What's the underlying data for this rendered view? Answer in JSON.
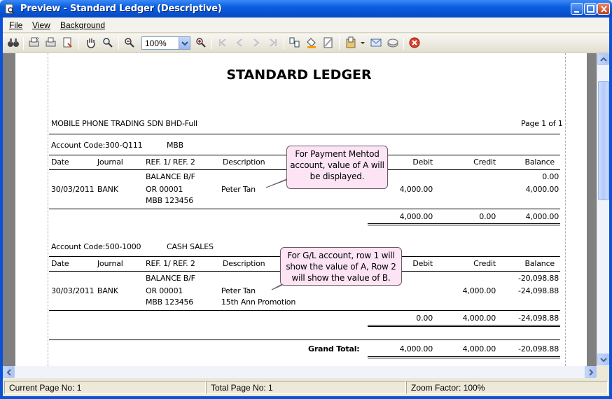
{
  "window": {
    "title": "Preview - Standard Ledger (Descriptive)"
  },
  "menu": [
    "File",
    "View",
    "Background"
  ],
  "toolbar": {
    "zoom_value": "100%"
  },
  "report": {
    "title": "STANDARD LEDGER",
    "company": "MOBILE PHONE TRADING SDN  BHD-Full",
    "page_info": "Page 1 of 1",
    "columns": {
      "date": "Date",
      "journal": "Journal",
      "ref": "REF. 1/ REF. 2",
      "description": "Description",
      "debit": "Debit",
      "credit": "Credit",
      "balance": "Balance"
    },
    "accounts": [
      {
        "label": "Account Code:",
        "code": "300-Q111",
        "name": "MBB",
        "bf_label": "BALANCE B/F",
        "bf_balance": "0.00",
        "date": "30/03/2011",
        "journal": "BANK",
        "ref1": "OR 00001",
        "ref2": "MBB 123456",
        "desc1": "Peter Tan",
        "desc2": "",
        "debit": "4,000.00",
        "credit": "",
        "balance": "4,000.00",
        "total_debit": "4,000.00",
        "total_credit": "0.00",
        "total_balance": "4,000.00"
      },
      {
        "label": "Account Code:",
        "code": "500-1000",
        "name": "CASH SALES",
        "bf_label": "BALANCE B/F",
        "bf_balance": "-20,098.88",
        "date": "30/03/2011",
        "journal": "BANK",
        "ref1": "OR 00001",
        "ref2": "MBB 123456",
        "desc1": "Peter Tan",
        "desc2": "15th Ann Promotion",
        "debit": "",
        "credit": "4,000.00",
        "balance": "-24,098.88",
        "total_debit": "0.00",
        "total_credit": "4,000.00",
        "total_balance": "-24,098.88"
      }
    ],
    "grand_total": {
      "label": "Grand Total:",
      "debit": "4,000.00",
      "credit": "4,000.00",
      "balance": "-20,098.88"
    }
  },
  "callouts": {
    "first": [
      "For Payment Mehtod",
      "account, value of A will",
      "be displayed."
    ],
    "second": [
      "For G/L account, row 1 will",
      "show the value of A, Row 2",
      "will show the value of B."
    ]
  },
  "status": {
    "current_page": "Current Page No: 1",
    "total_page": "Total Page No: 1",
    "zoom": "Zoom Factor: 100%"
  }
}
